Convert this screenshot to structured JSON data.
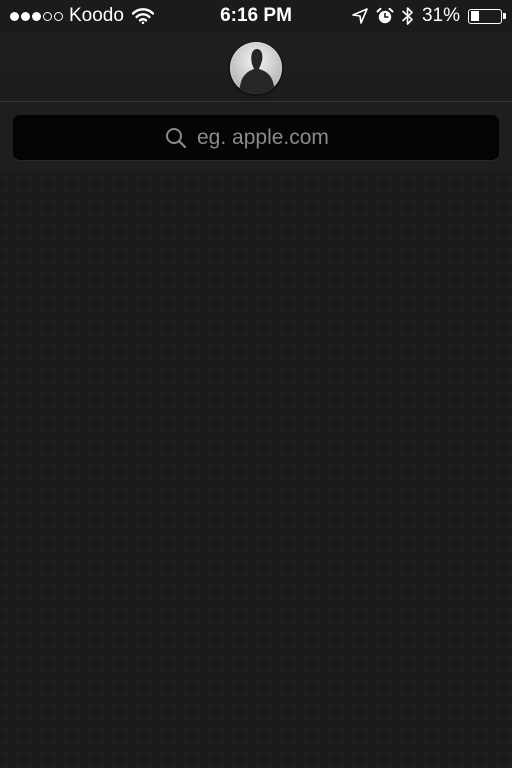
{
  "status_bar": {
    "carrier": "Koodo",
    "signal_bars_filled": 3,
    "signal_bars_total": 5,
    "time": "6:16 PM",
    "battery_percent": "31%",
    "battery_level": 0.31
  },
  "icons": {
    "wifi": "wifi-icon",
    "location": "location-arrow-icon",
    "alarm": "alarm-clock-icon",
    "bluetooth": "bluetooth-icon",
    "battery": "battery-icon",
    "avatar": "user-silhouette-icon",
    "search": "search-icon"
  },
  "search": {
    "placeholder": "eg. apple.com",
    "value": ""
  },
  "colors": {
    "background": "#1b1b1b",
    "search_field": "#050505",
    "text": "#ffffff",
    "placeholder": "#8a8a8a"
  }
}
